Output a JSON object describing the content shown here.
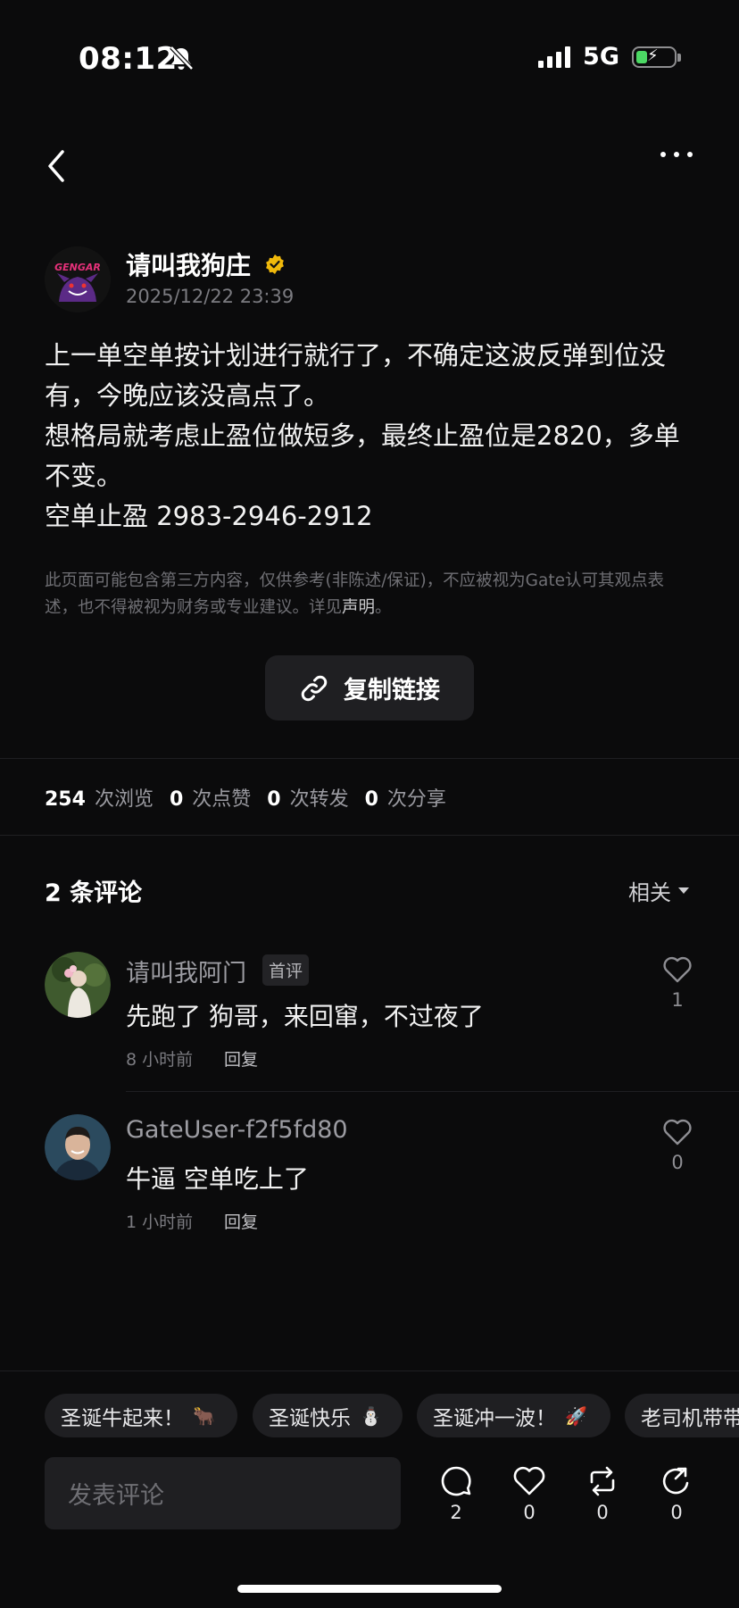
{
  "status": {
    "time": "08:12",
    "network": "5G"
  },
  "post": {
    "author": "请叫我狗庄",
    "timestamp": "2025/12/22 23:39",
    "avatar_text": "GENGAR",
    "body": [
      "上一单空单按计划进行就行了，不确定这波反弹到位没有，今晚应该没高点了。",
      "想格局就考虑止盈位做短多，最终止盈位是2820，多单不变。",
      "空单止盈 2983-2946-2912"
    ],
    "disclaimer": "此页面可能包含第三方内容，仅供参考(非陈述/保证)，不应被视为Gate认可其观点表述，也不得被视为财务或专业建议。详见",
    "disclaimer_link": "声明",
    "disclaimer_end": "。",
    "copy_link_label": "复制链接"
  },
  "stats": [
    {
      "value": "254",
      "label": "次浏览"
    },
    {
      "value": "0",
      "label": "次点赞"
    },
    {
      "value": "0",
      "label": "次转发"
    },
    {
      "value": "0",
      "label": "次分享"
    }
  ],
  "comments": {
    "title": "2 条评论",
    "sort_label": "相关",
    "items": [
      {
        "name": "请叫我阿门",
        "badge": "首评",
        "text": "先跑了 狗哥，来回窜，不过夜了",
        "time": "8 小时前",
        "reply": "回复",
        "likes": "1"
      },
      {
        "name": "GateUser-f2f5fd80",
        "badge": "",
        "text": "牛逼 空单吃上了",
        "time": "1 小时前",
        "reply": "回复",
        "likes": "0"
      }
    ]
  },
  "quick_replies": [
    {
      "text": "圣诞牛起来！",
      "emoji": "🐂"
    },
    {
      "text": "圣诞快乐",
      "emoji": "⛄"
    },
    {
      "text": "圣诞冲一波！",
      "emoji": "🚀"
    },
    {
      "text": "老司机带带",
      "emoji": ""
    }
  ],
  "bottom_bar": {
    "input_placeholder": "发表评论",
    "comment_count": "2",
    "like_count": "0",
    "repost_count": "0",
    "share_count": "0"
  },
  "colors": {
    "background": "#0b0b0c",
    "surface": "#1f1f22",
    "verified": "#f0b90b",
    "battery": "#4cd964"
  }
}
